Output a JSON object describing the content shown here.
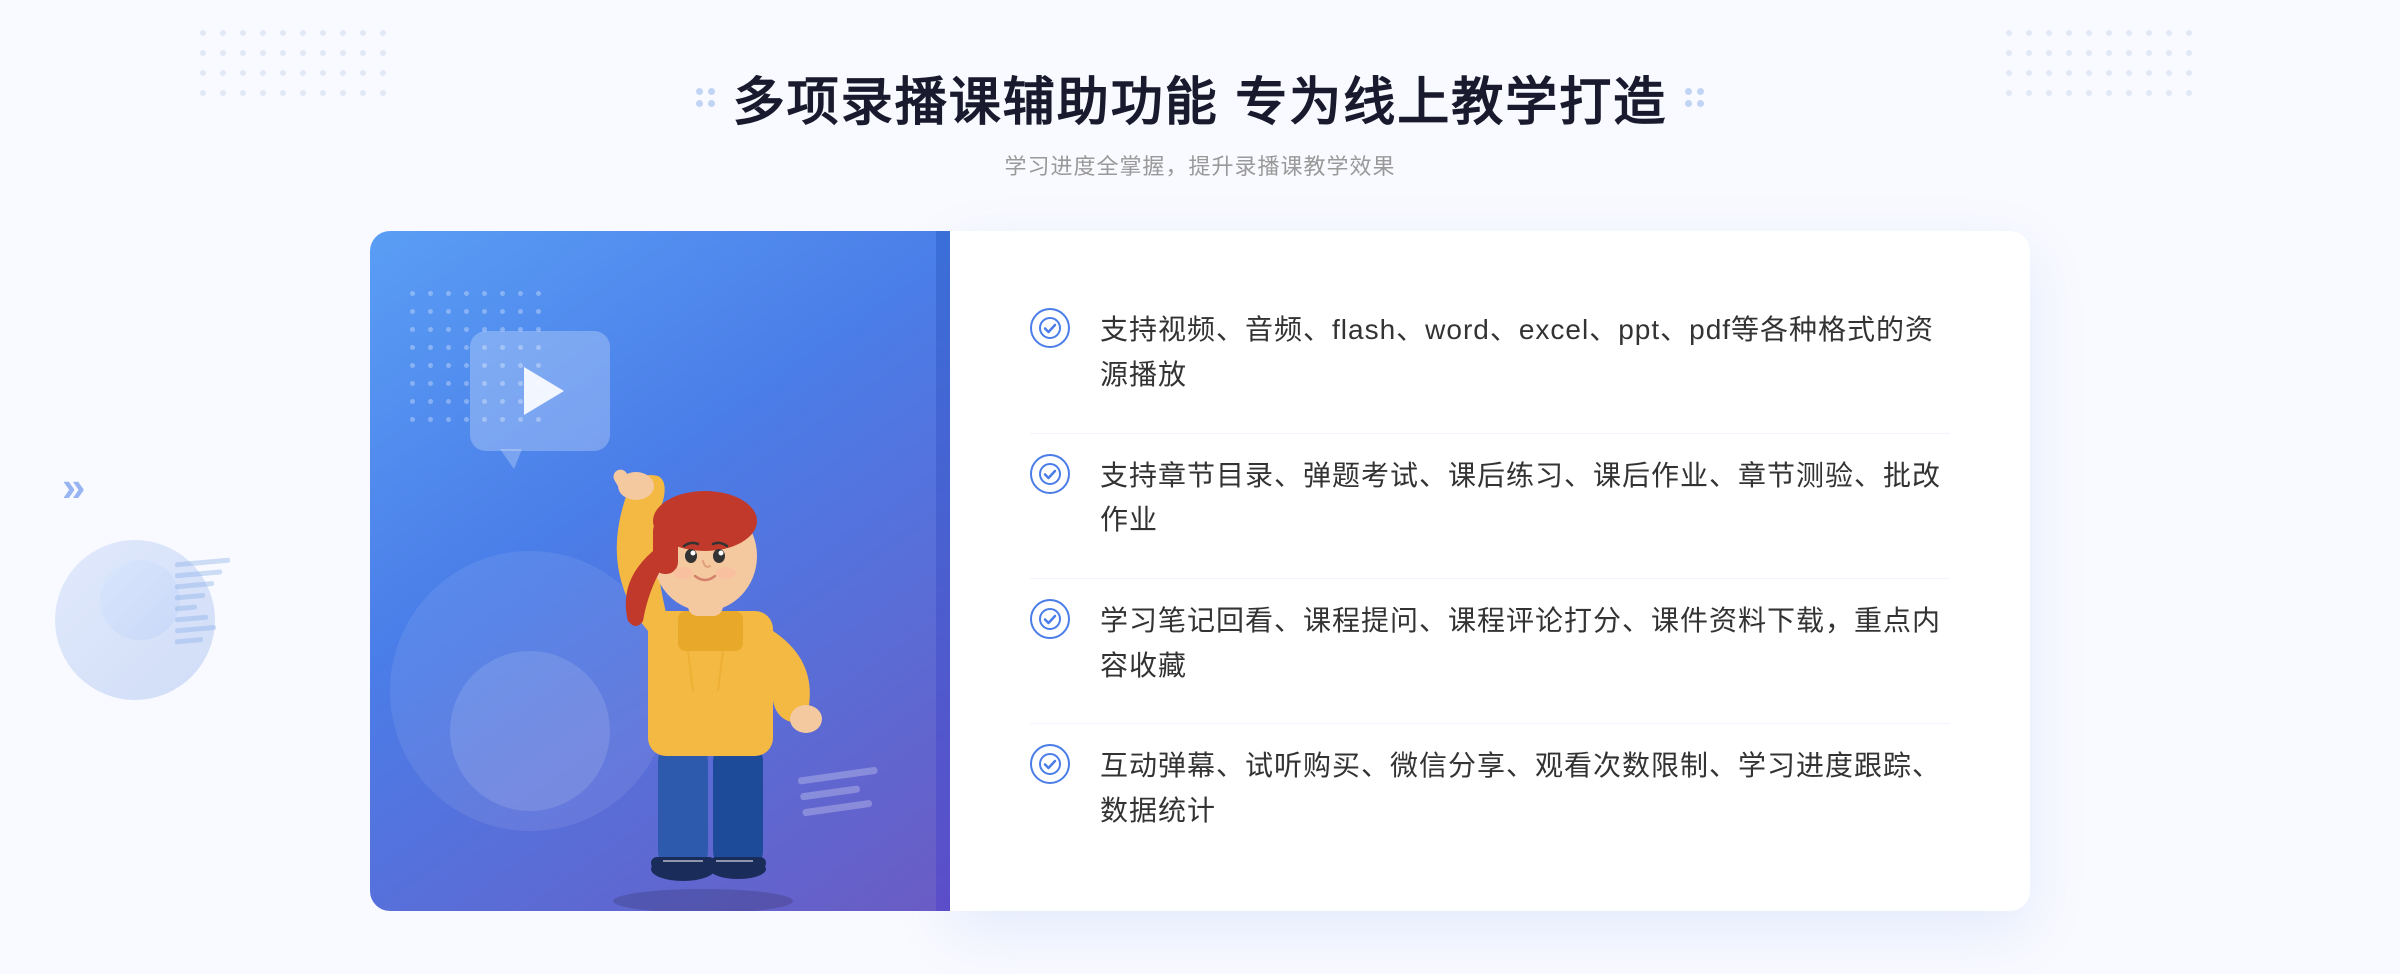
{
  "header": {
    "title": "多项录播课辅助功能 专为线上教学打造",
    "subtitle": "学习进度全掌握，提升录播课教学效果"
  },
  "features": [
    {
      "id": "feature-1",
      "text": "支持视频、音频、flash、word、excel、ppt、pdf等各种格式的资源播放"
    },
    {
      "id": "feature-2",
      "text": "支持章节目录、弹题考试、课后练习、课后作业、章节测验、批改作业"
    },
    {
      "id": "feature-3",
      "text": "学习笔记回看、课程提问、课程评论打分、课件资料下载，重点内容收藏"
    },
    {
      "id": "feature-4",
      "text": "互动弹幕、试听购买、微信分享、观看次数限制、学习进度跟踪、数据统计"
    }
  ],
  "colors": {
    "primary": "#4a7de8",
    "gradient_start": "#5a9ef5",
    "gradient_end": "#6b5bc4",
    "text_dark": "#1a1a2e",
    "text_light": "#999999",
    "text_feature": "#333333"
  },
  "decorative": {
    "chevron_symbol": "»",
    "play_button": "▶"
  }
}
